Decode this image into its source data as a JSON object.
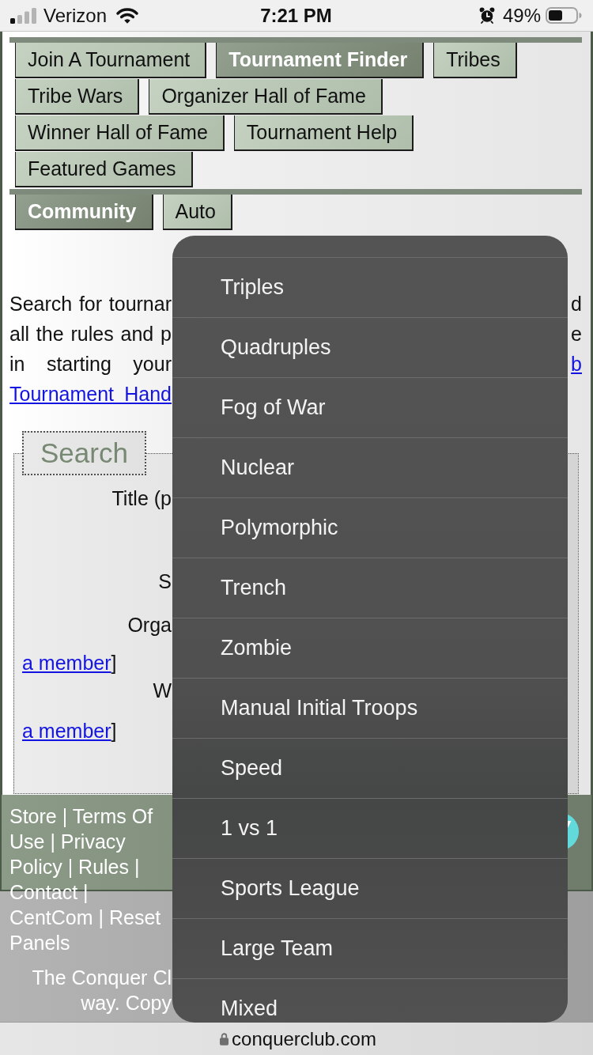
{
  "status_bar": {
    "carrier": "Verizon",
    "time": "7:21 PM",
    "battery": "49%"
  },
  "nav": {
    "primary_tabs": [
      {
        "label": "Join A Tournament",
        "selected": false
      },
      {
        "label": "Tournament Finder",
        "selected": true
      },
      {
        "label": "Tribes",
        "selected": false
      },
      {
        "label": "Tribe Wars",
        "selected": false
      },
      {
        "label": "Organizer Hall of Fame",
        "selected": false
      },
      {
        "label": "Winner Hall of Fame",
        "selected": false
      },
      {
        "label": "Tournament Help",
        "selected": false
      },
      {
        "label": "Featured Games",
        "selected": false
      }
    ],
    "secondary_tabs": [
      {
        "label": "Community",
        "selected": true
      },
      {
        "label": "Auto",
        "selected": false
      }
    ]
  },
  "intro_lines": [
    {
      "left": {
        "text": "Search for tournar",
        "link": false
      },
      "right": {
        "text": "d",
        "link": false
      }
    },
    {
      "left": {
        "text": "all the rules and p",
        "link": false
      },
      "right": {
        "text": "e",
        "link": false
      }
    },
    {
      "left": {
        "text": "in starting your",
        "link": false
      },
      "right": {
        "text": "b",
        "link": true
      }
    },
    {
      "left": {
        "text": "Tournament Hand",
        "link": true
      }
    }
  ],
  "search_panel": {
    "legend": "Search",
    "rows": [
      {
        "kind": "label",
        "text": "Title (p"
      },
      {
        "kind": "label",
        "text": "S"
      },
      {
        "kind": "label",
        "text": "Orga"
      },
      {
        "kind": "link",
        "text": "a member",
        "suffix": "]"
      },
      {
        "kind": "label",
        "text": "W"
      },
      {
        "kind": "link",
        "text": "a member",
        "suffix": "]"
      }
    ]
  },
  "footer": {
    "links": "Store | Terms Of Use | Privacy Policy | Rules | Contact | CentCom | Reset Panels",
    "copyright_lines": [
      "The Conquer Cl",
      "way. Copy"
    ]
  },
  "dropdown": {
    "options": [
      {
        "label": "Triples",
        "selected": false
      },
      {
        "label": "Quadruples",
        "selected": false
      },
      {
        "label": "Fog of War",
        "selected": false
      },
      {
        "label": "Nuclear",
        "selected": false
      },
      {
        "label": "Polymorphic",
        "selected": false
      },
      {
        "label": "Trench",
        "selected": false
      },
      {
        "label": "Zombie",
        "selected": false
      },
      {
        "label": "Manual Initial Troops",
        "selected": false
      },
      {
        "label": "Speed",
        "selected": false
      },
      {
        "label": "1 vs 1",
        "selected": false
      },
      {
        "label": "Sports League",
        "selected": false
      },
      {
        "label": "Large Team",
        "selected": false
      },
      {
        "label": "Mixed",
        "selected": false
      }
    ]
  },
  "address_bar": {
    "url": "conquerclub.com"
  }
}
